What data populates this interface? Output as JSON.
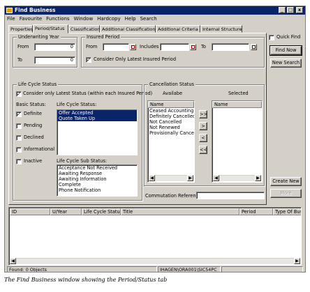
{
  "window": {
    "title": "Find Business",
    "min_glyph": "_",
    "max_glyph": "□",
    "close_glyph": "x"
  },
  "menu": [
    "File",
    "Favourite",
    "Functions",
    "Window",
    "Hardcopy",
    "Help",
    "Search"
  ],
  "tabs": [
    "Properties",
    "Period/Status",
    "Classification",
    "Additional Classification",
    "Additional Criteria",
    "Internal Structure"
  ],
  "active_tab": "Period/Status",
  "underwriting": {
    "title": "Underwriting Year",
    "from_label": "From",
    "from_value": "0",
    "to_label": "To",
    "to_value": "0"
  },
  "insured": {
    "title": "Insured Period",
    "from_label": "From",
    "includes_label": "Includes",
    "to_label": "To",
    "consider_label": "Consider Only Latest Insured Period",
    "consider_checked": true
  },
  "lifecycle": {
    "title": "Life Cycle Status",
    "consider_label": "Consider only Latest Status (within each Insured Period)",
    "consider_checked": true,
    "basic_label": "Basic Status:",
    "basic": [
      {
        "label": "Definite",
        "checked": true
      },
      {
        "label": "Pending",
        "checked": false
      },
      {
        "label": "Declined",
        "checked": false
      },
      {
        "label": "Informational",
        "checked": false
      },
      {
        "label": "Inactive",
        "checked": false
      }
    ],
    "status_label": "Life Cycle Status:",
    "status_items": [
      "Offer Accepted",
      "Quote Taken Up"
    ],
    "sub_label": "Life Cycle Sub Status:",
    "sub_items": [
      "Acceptance Not Received",
      "Awaiting Response",
      "Awaiting Information",
      "Complete",
      "Phone Notification"
    ]
  },
  "cancellation": {
    "title": "Cancellation Status",
    "available_label": "Availabe",
    "selected_label": "Selected",
    "name_header": "Name",
    "available_items": [
      "Ceased Accounting",
      "Definitely Cancelled",
      "Not Cancelled",
      "Not Renewed",
      "Provisionally Cancelled"
    ],
    "move_all_right": ">>",
    "move_right": ">",
    "move_left": "<",
    "move_all_left": "<<"
  },
  "commutation": {
    "label": "Commutation Reference",
    "value": ""
  },
  "side_buttons": {
    "quick_find_label": "Quick Find",
    "quick_find_checked": false,
    "find_now": "Find Now",
    "new_search": "New Search",
    "create_new": "Create New",
    "more": "More"
  },
  "results": {
    "columns": [
      "ID",
      "U/Year",
      "Life Cycle Status",
      "Title",
      "Period",
      "Type Of Busin"
    ]
  },
  "status": {
    "count": "Found: 0 Objects",
    "connection": "IHAGEN\\ORA001\\SIC54PC"
  },
  "caption": "The Find Business window showing the Period/Status tab"
}
